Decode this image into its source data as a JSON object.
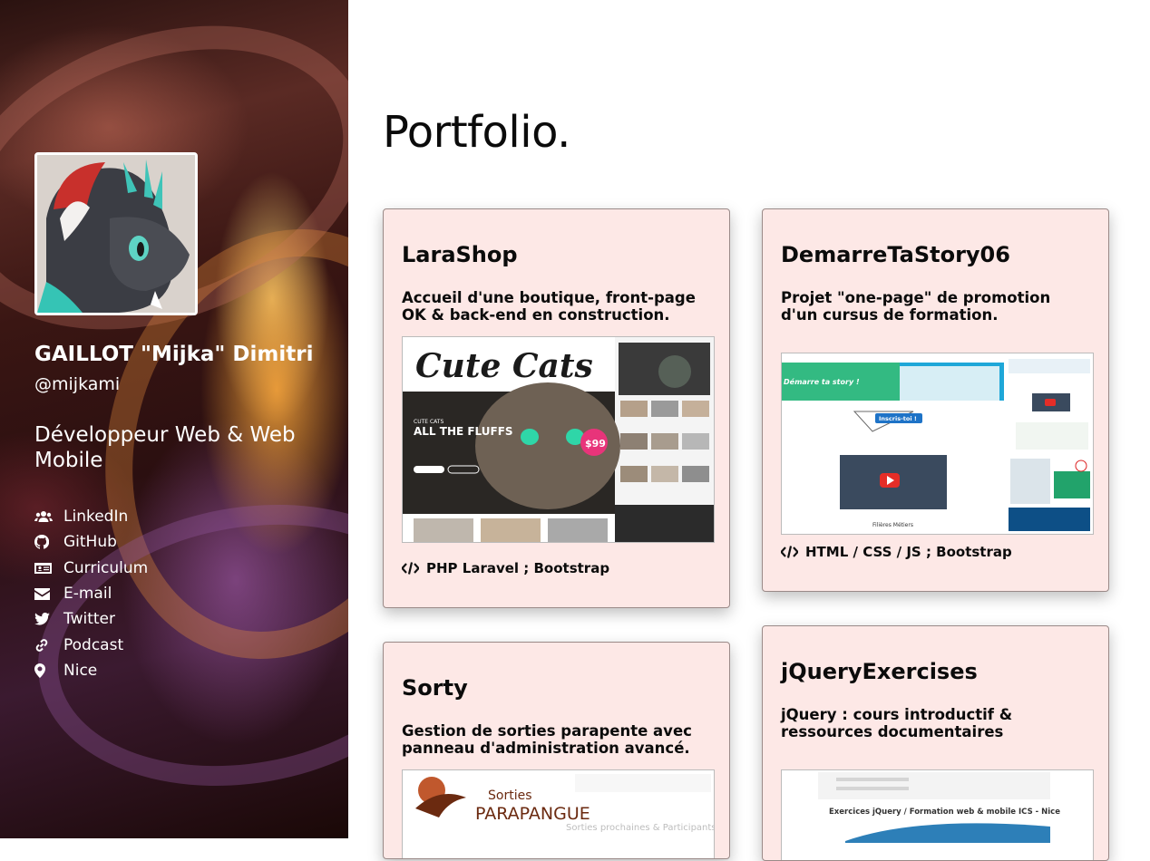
{
  "profile": {
    "name": "GAILLOT \"Mijka\" Dimitri",
    "handle": "@mijkami",
    "role": "Développeur Web & Web Mobile"
  },
  "sidebar": {
    "links": [
      {
        "label": "LinkedIn",
        "icon": "users-icon"
      },
      {
        "label": "GitHub",
        "icon": "github-icon"
      },
      {
        "label": "Curriculum",
        "icon": "id-card-icon"
      },
      {
        "label": "E-mail",
        "icon": "envelope-icon"
      },
      {
        "label": "Twitter",
        "icon": "twitter-icon"
      },
      {
        "label": "Podcast",
        "icon": "link-icon"
      },
      {
        "label": "Nice",
        "icon": "map-marker-icon"
      }
    ]
  },
  "main": {
    "title": "Portfolio.",
    "projects": [
      {
        "title": "LaraShop",
        "description": "Accueil d'une boutique, front-page OK & back-end en construction.",
        "tech": "PHP Laravel ; Bootstrap",
        "thumb": {
          "brand": "Cute Cats",
          "headline": "ALL THE FLUFFS",
          "price": "$99",
          "label": "CUTE CATS"
        }
      },
      {
        "title": "DemarreTaStory06",
        "description": "Projet \"one-page\" de promotion d'un cursus de formation.",
        "tech": "HTML / CSS / JS ; Bootstrap",
        "thumb": {
          "banner": "Démarre ta story !",
          "cta": "Inscris-toi !",
          "caption": "Filières Métiers"
        }
      },
      {
        "title": "Sorty",
        "description": "Gestion de sorties parapente avec panneau d'administration avancé.",
        "thumb": {
          "brand_top": "Sorties",
          "brand_main": "PARAPANGUE",
          "subtitle": "Sorties prochaines & Participants"
        }
      },
      {
        "title": "jQueryExercises",
        "description": "jQuery : cours introductif & ressources documentaires",
        "thumb": {
          "caption": "Exercices jQuery / Formation web & mobile ICS - Nice"
        }
      }
    ]
  },
  "colors": {
    "card_bg": "#fde8e6",
    "sidebar_text": "#ffffff",
    "page_bg": "#ffffff"
  }
}
